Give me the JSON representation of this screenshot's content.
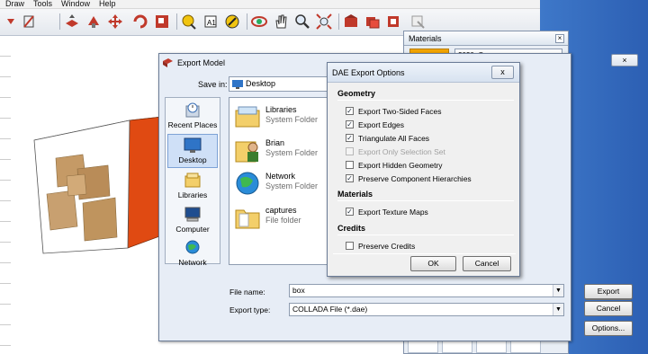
{
  "menu": [
    "Draw",
    "Tools",
    "Window",
    "Help"
  ],
  "materials_panel": {
    "title": "Materials",
    "close_icon": "close-icon",
    "combo_value": "2020_Orange",
    "swatch_color": "#f2a400"
  },
  "export_dialog": {
    "title": "Export Model",
    "save_in_label": "Save in:",
    "save_in_value": "Desktop",
    "places": [
      {
        "label": "Recent Places",
        "icon": "recent-places-icon"
      },
      {
        "label": "Desktop",
        "icon": "desktop-icon"
      },
      {
        "label": "Libraries",
        "icon": "libraries-icon"
      },
      {
        "label": "Computer",
        "icon": "computer-icon"
      },
      {
        "label": "Network",
        "icon": "network-icon"
      }
    ],
    "files": [
      {
        "name": "Libraries",
        "type": "System Folder",
        "icon": "libraries-folder-icon"
      },
      {
        "name": "Brian",
        "type": "System Folder",
        "icon": "user-folder-icon"
      },
      {
        "name": "Network",
        "type": "System Folder",
        "icon": "network-globe-icon"
      },
      {
        "name": "captures",
        "type": "File folder",
        "icon": "folder-icon"
      }
    ],
    "file_name_label": "File name:",
    "file_name_value": "box",
    "export_type_label": "Export type:",
    "export_type_value": "COLLADA File (*.dae)",
    "buttons": {
      "export": "Export",
      "cancel": "Cancel",
      "options": "Options..."
    }
  },
  "dae_dialog": {
    "title": "DAE Export Options",
    "close": "x",
    "sections": {
      "geometry": "Geometry",
      "materials": "Materials",
      "credits": "Credits"
    },
    "geometry_options": [
      {
        "label": "Export Two-Sided Faces",
        "checked": true,
        "enabled": true
      },
      {
        "label": "Export Edges",
        "checked": true,
        "enabled": true
      },
      {
        "label": "Triangulate All Faces",
        "checked": true,
        "enabled": true
      },
      {
        "label": "Export Only Selection Set",
        "checked": false,
        "enabled": false
      },
      {
        "label": "Export Hidden Geometry",
        "checked": false,
        "enabled": true
      },
      {
        "label": "Preserve Component Hierarchies",
        "checked": true,
        "enabled": true
      }
    ],
    "material_options": [
      {
        "label": "Export Texture Maps",
        "checked": true,
        "enabled": true
      }
    ],
    "credit_options": [
      {
        "label": "Preserve Credits",
        "checked": false,
        "enabled": true
      }
    ],
    "ok_label": "OK",
    "cancel_label": "Cancel"
  },
  "colors": {
    "cube_side": "#e04a12",
    "checkmark": "#1d2a3a",
    "dialog_bg": "#e7edf6"
  }
}
